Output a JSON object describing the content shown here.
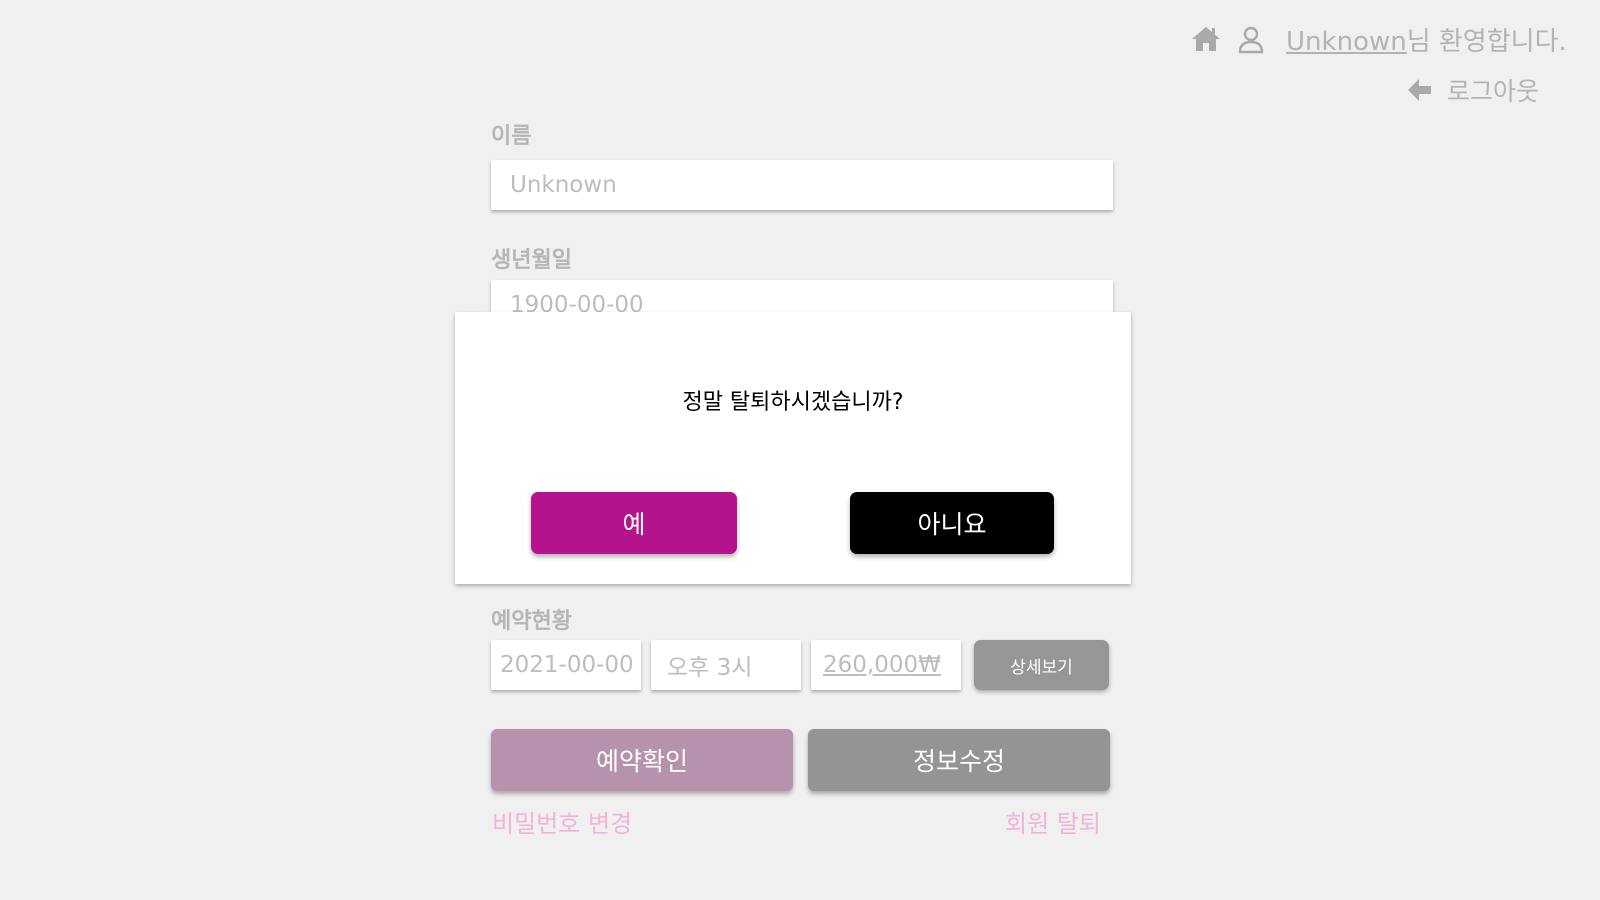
{
  "header": {
    "icons": [
      "home-icon",
      "user-icon"
    ],
    "username": "Unknown",
    "welcome_suffix": "님 환영합니다.",
    "logout_icon": "arrow-left-icon",
    "logout_label": "로그아웃"
  },
  "form": {
    "name_label": "이름",
    "name_value": "Unknown",
    "birth_label": "생년월일",
    "birth_value": "1900-00-00"
  },
  "reservation": {
    "label": "예약현황",
    "date": "2021-00-00",
    "time": "오후 3시",
    "price": "260,000₩",
    "detail_button": "상세보기"
  },
  "actions": {
    "confirm_button": "예약확인",
    "edit_button": "정보수정",
    "change_password": "비밀번호 변경",
    "withdraw": "회원 탈퇴"
  },
  "modal": {
    "message": "정말 탈퇴하시겠습니까?",
    "yes": "예",
    "no": "아니요"
  },
  "colors": {
    "background": "#f0f0f0",
    "primary_magenta": "#b5128e",
    "muted_pink_button": "#b792ad",
    "gray_button": "#949494",
    "pink_link": "#f3b2d8",
    "muted_text": "#b3b3b3"
  }
}
